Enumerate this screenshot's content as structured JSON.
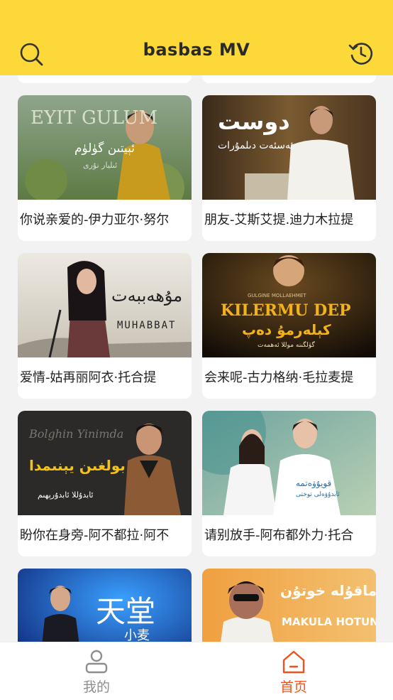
{
  "header": {
    "title": "basbas  MV",
    "search_icon": "search-icon",
    "history_icon": "history-icon"
  },
  "videos": [
    {
      "caption": "你说亲爱的-伊力亚尔·努尔",
      "thumb_text": "EYIT GULUM",
      "thumb_text2": "ئېيتىن گۈلۈم",
      "thumb_text3": "ئىليار نۇرى"
    },
    {
      "caption": "朋友-艾斯艾提.迪力木拉提",
      "thumb_text": "دوست",
      "thumb_text2": "ئەسئەت دىلمۇرات"
    },
    {
      "caption": "爱情-姑再丽阿衣·托合提",
      "thumb_text": "مۇھەببەت",
      "thumb_text2": "MUHABBAT"
    },
    {
      "caption": "会来呢-古力格纳·毛拉麦提",
      "thumb_text": "KILERMU DEP",
      "thumb_text2": "كېلەرمۇ دەپ",
      "thumb_text3": "GULGINE MOLLAEHMET",
      "thumb_text4": "گۈلگىنە موللا ئەھمەت"
    },
    {
      "caption": "盼你在身旁-阿不都拉·阿不",
      "thumb_text": "Bolghin Yinimda",
      "thumb_text2": "بولغىن يېنىمدا",
      "thumb_text3": "ئابدۇللا ئابدۇرېھىم"
    },
    {
      "caption": "请别放手-阿布都外力·托合",
      "thumb_text": "قويۇۋەتمە",
      "thumb_text2": "ئابدۇۋەلى توختى"
    },
    {
      "caption": "",
      "thumb_text": "天堂",
      "thumb_text2": "小麦"
    },
    {
      "caption": "",
      "thumb_text": "ماقۇلە خوتۇن",
      "thumb_text2": "MAKULA HOTUN"
    }
  ],
  "tabbar": {
    "mine_label": "我的",
    "home_label": "首页",
    "mine_icon": "user-icon",
    "home_icon": "home-icon",
    "active_color": "#f0521f",
    "inactive_color": "#8e8e8e"
  },
  "colors": {
    "header_bg": "#fcd939",
    "page_bg": "#f2f2f2"
  }
}
